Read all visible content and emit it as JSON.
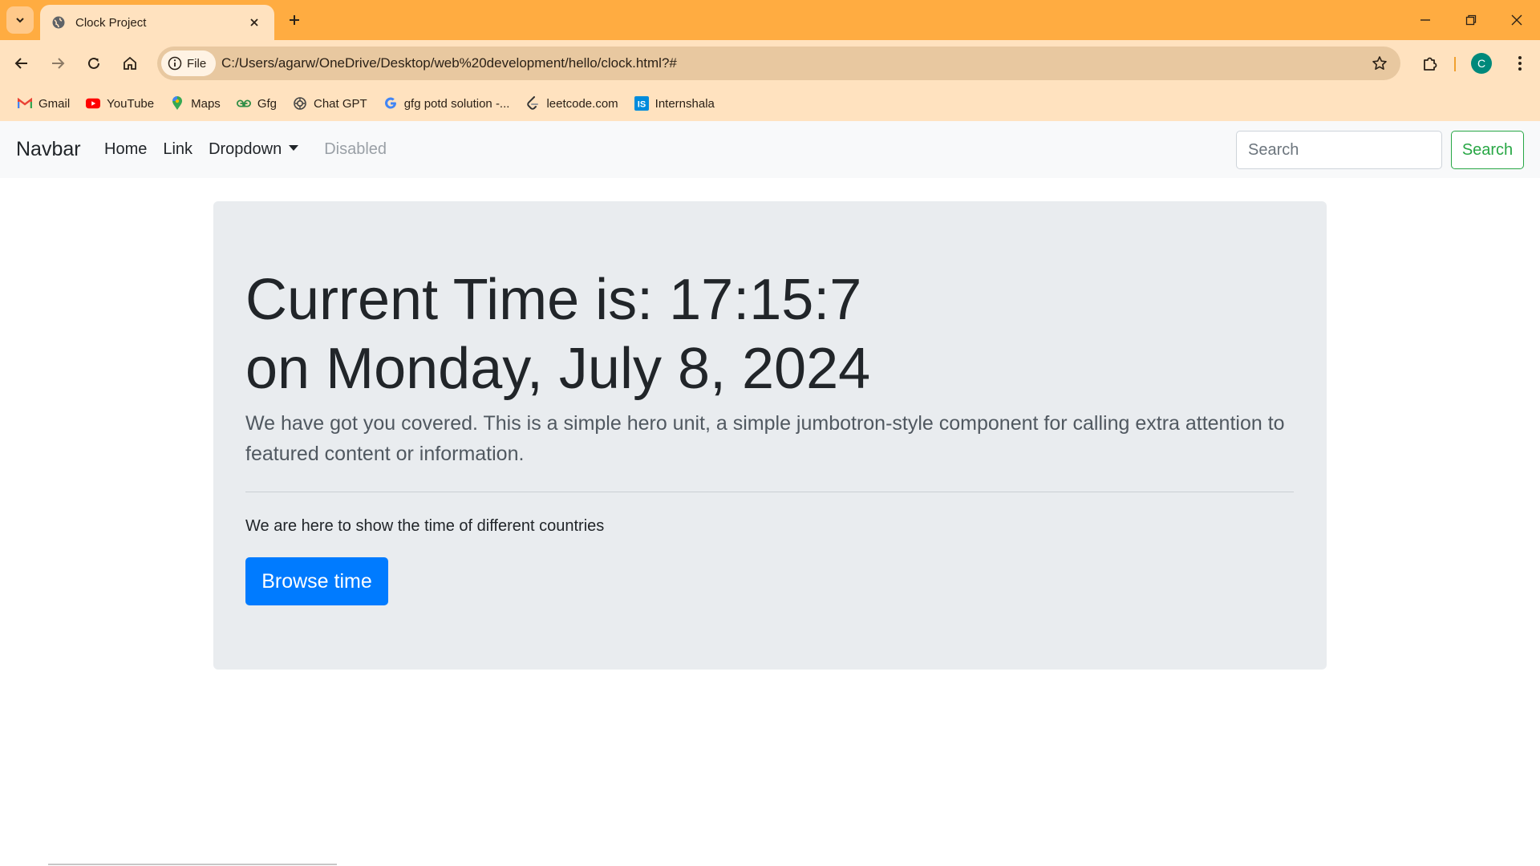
{
  "browser": {
    "tab_title": "Clock Project",
    "file_label": "File",
    "url": "C:/Users/agarw/OneDrive/Desktop/web%20development/hello/clock.html?#",
    "profile_initial": "C",
    "bookmarks": [
      {
        "label": "Gmail",
        "icon": "gmail-icon",
        "color": "#ea4335"
      },
      {
        "label": "YouTube",
        "icon": "youtube-icon",
        "color": "#ff0000"
      },
      {
        "label": "Maps",
        "icon": "maps-icon",
        "color": "#34a853"
      },
      {
        "label": "Gfg",
        "icon": "gfg-icon",
        "color": "#2f8d46"
      },
      {
        "label": "Chat GPT",
        "icon": "chatgpt-icon",
        "color": "#444444"
      },
      {
        "label": "gfg potd solution -...",
        "icon": "google-icon",
        "color": "#4285f4"
      },
      {
        "label": "leetcode.com",
        "icon": "leetcode-icon",
        "color": "#333333"
      },
      {
        "label": "Internshala",
        "icon": "internshala-icon",
        "color": "#008bdc"
      }
    ]
  },
  "navbar": {
    "brand": "Navbar",
    "links": [
      "Home",
      "Link",
      "Dropdown"
    ],
    "disabled_link": "Disabled",
    "search_placeholder": "Search",
    "search_button": "Search"
  },
  "hero": {
    "title_line1": "Current Time is: 17:15:7",
    "title_line2": "on Monday, July 8, 2024",
    "lead": "We have got you covered. This is a simple hero unit, a simple jumbotron-style component for calling extra attention to featured content or information.",
    "text": "We are here to show the time of different countries",
    "button": "Browse time"
  },
  "colors": {
    "tabstrip": "#ffac41",
    "toolbar": "#ffe2bf",
    "primary_button": "#007bff",
    "success_outline": "#28a745",
    "hero_bg": "#e9ecef"
  }
}
